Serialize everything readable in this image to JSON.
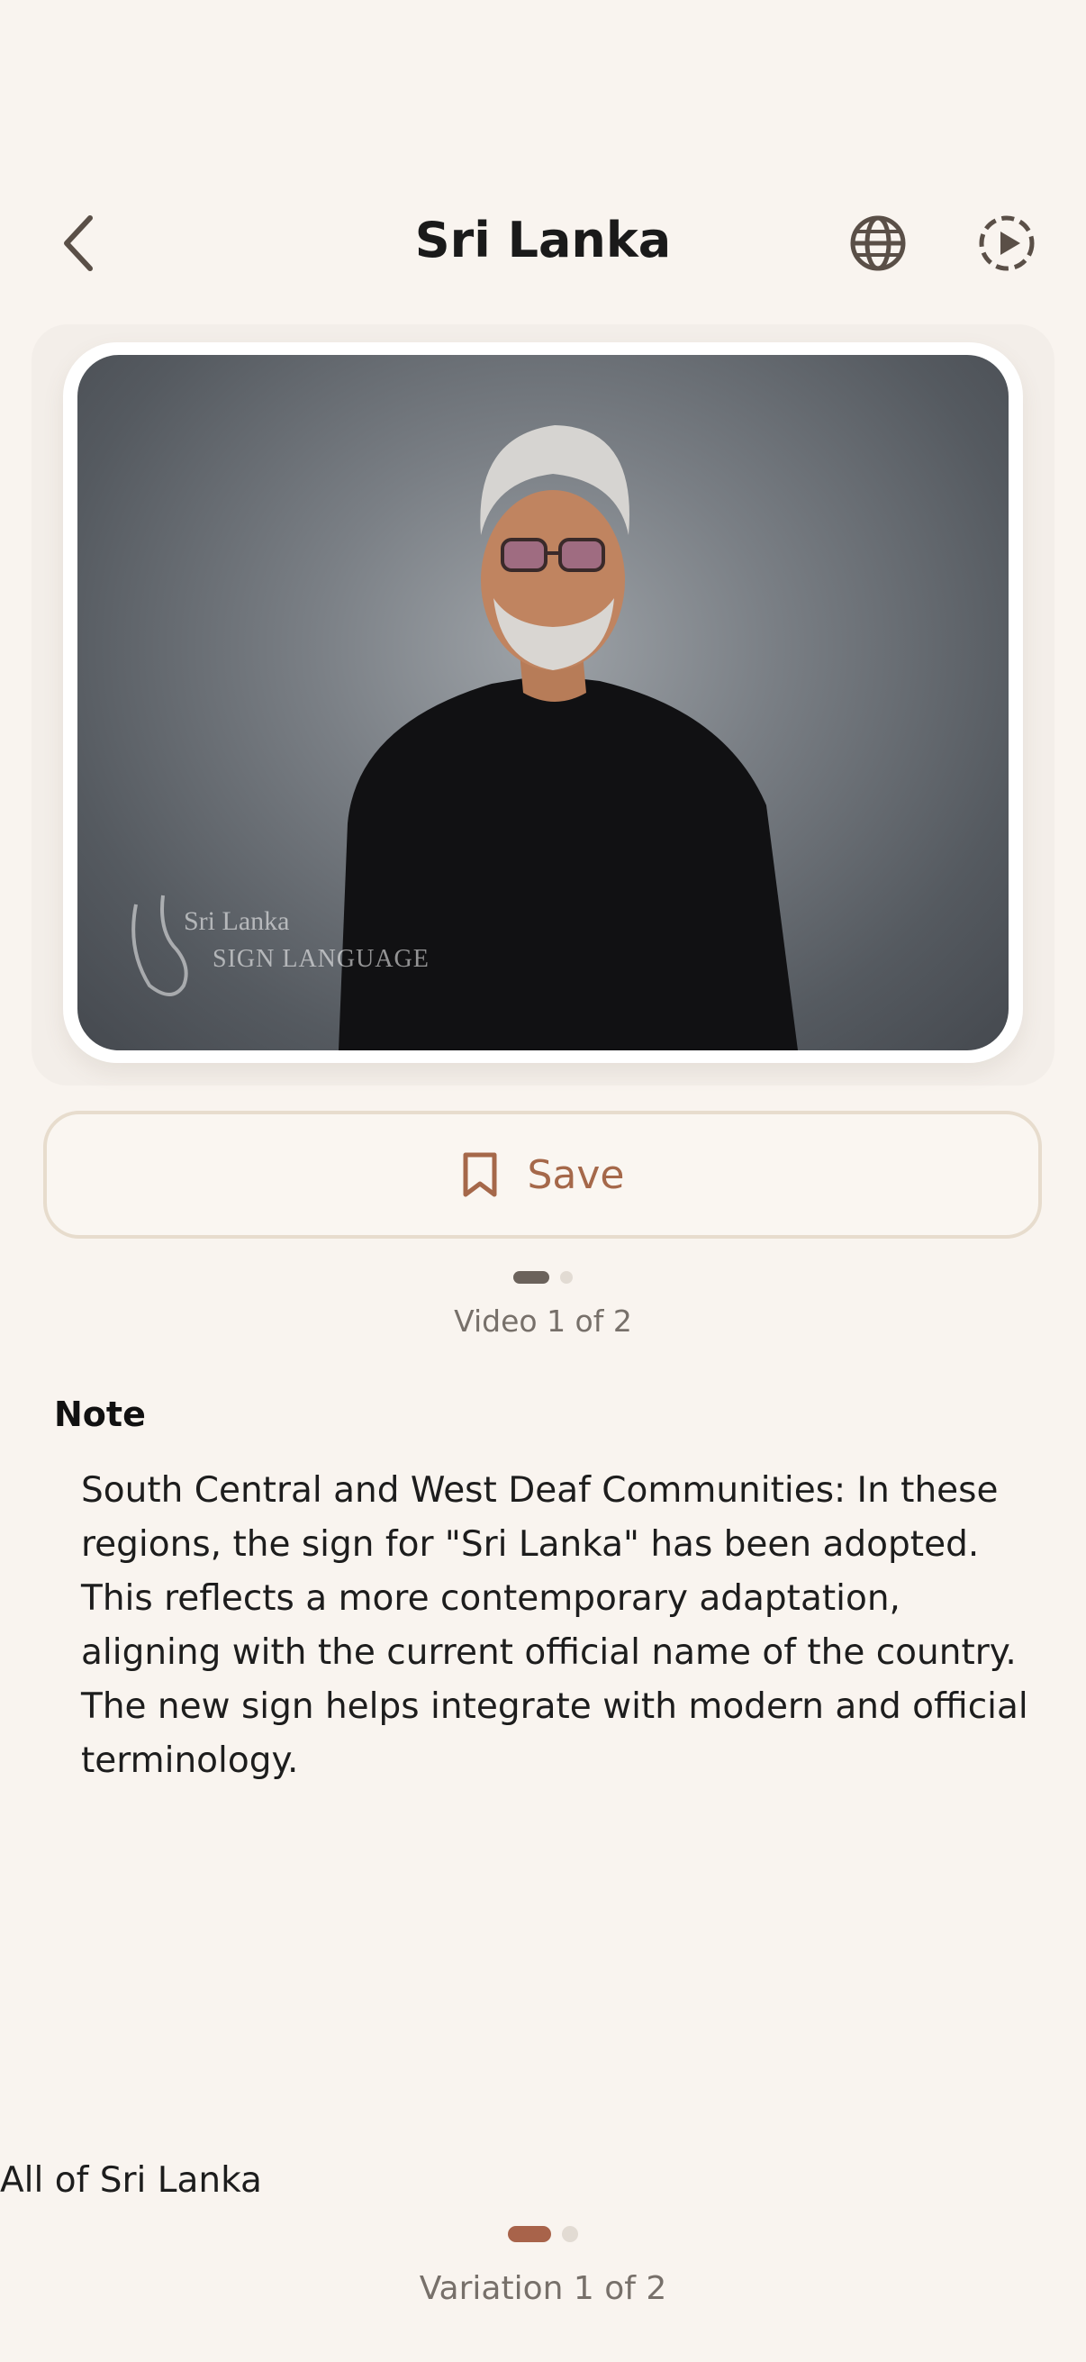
{
  "header": {
    "title": "Sri Lanka",
    "back_icon": "chevron-left-icon",
    "globe_icon": "globe-icon",
    "play_icon": "play-circle-icon"
  },
  "video": {
    "watermark_line1": "Sri Lanka",
    "watermark_line2": "SIGN LANGUAGE",
    "counter": "Video 1 of 2"
  },
  "save": {
    "label": "Save",
    "icon": "bookmark-icon"
  },
  "note": {
    "heading": "Note",
    "body": "South Central and West Deaf Communities: In these regions, the sign for \"Sri Lanka\" has been adopted. This reflects a more contemporary adaptation, aligning with the current official name of the country. The new sign helps integrate with modern and official terminology."
  },
  "variation": {
    "region": "All of Sri Lanka",
    "counter": "Variation 1 of 2"
  },
  "colors": {
    "background": "#f9f4ef",
    "accent": "#a5684a",
    "border": "#e7dccd"
  }
}
